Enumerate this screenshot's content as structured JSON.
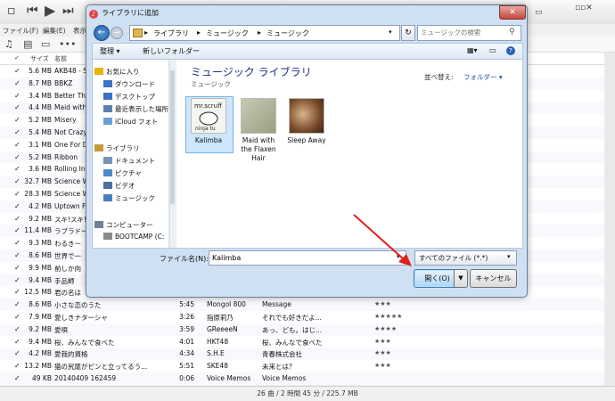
{
  "itunes": {
    "menus": [
      "ファイル(F)",
      "編集(E)",
      "表示"
    ],
    "colhead": {
      "size": "サイズ",
      "name": "名前"
    },
    "rows": [
      {
        "check": "✓",
        "size": "5.6 MB",
        "name": "AKB48 - S",
        "time": "",
        "artist": "",
        "album": "",
        "rating": ""
      },
      {
        "check": "✓",
        "size": "8.7 MB",
        "name": "BBKZ",
        "time": "",
        "artist": "",
        "album": "",
        "rating": ""
      },
      {
        "check": "✓",
        "size": "3.4 MB",
        "name": "Better Tha",
        "time": "",
        "artist": "",
        "album": "",
        "rating": ""
      },
      {
        "check": "✓",
        "size": "4.4 MB",
        "name": "Maid with",
        "time": "",
        "artist": "",
        "album": "",
        "rating": ""
      },
      {
        "check": "✓",
        "size": "5.2 MB",
        "name": "Misery",
        "time": "",
        "artist": "",
        "album": "",
        "rating": ""
      },
      {
        "check": "✓",
        "size": "5.4 MB",
        "name": "Not Crazy",
        "time": "",
        "artist": "",
        "album": "",
        "rating": ""
      },
      {
        "check": "✓",
        "size": "3.1 MB",
        "name": "One For D",
        "time": "",
        "artist": "",
        "album": "",
        "rating": ""
      },
      {
        "check": "✓",
        "size": "5.2 MB",
        "name": "Ribbon",
        "time": "",
        "artist": "",
        "album": "",
        "rating": ""
      },
      {
        "check": "✓",
        "size": "3.6 MB",
        "name": "Rolling In",
        "time": "",
        "artist": "",
        "album": "",
        "rating": ""
      },
      {
        "check": "✓",
        "size": "32.7 MB",
        "name": "Science W",
        "time": "",
        "artist": "",
        "album": "",
        "rating": ""
      },
      {
        "check": "✓",
        "size": "28.3 MB",
        "name": "Science W",
        "time": "",
        "artist": "",
        "album": "",
        "rating": ""
      },
      {
        "check": "✓",
        "size": "4.2 MB",
        "name": "Uptown Fu",
        "time": "",
        "artist": "",
        "album": "",
        "rating": ""
      },
      {
        "check": "✓",
        "size": "9.2 MB",
        "name": "スキ!スキ!",
        "time": "",
        "artist": "",
        "album": "",
        "rating": ""
      },
      {
        "check": "✓",
        "size": "11.4 MB",
        "name": "ラブラドー",
        "time": "",
        "artist": "",
        "album": "",
        "rating": ""
      },
      {
        "check": "✓",
        "size": "9.3 MB",
        "name": "わるきー",
        "time": "",
        "artist": "",
        "album": "",
        "rating": ""
      },
      {
        "check": "✓",
        "size": "8.6 MB",
        "name": "世界で一",
        "time": "",
        "artist": "",
        "album": "",
        "rating": ""
      },
      {
        "check": "✓",
        "size": "9.9 MB",
        "name": "前しか向",
        "time": "",
        "artist": "",
        "album": "",
        "rating": ""
      },
      {
        "check": "✓",
        "size": "9.4 MB",
        "name": "手品師",
        "time": "",
        "artist": "",
        "album": "",
        "rating": ""
      },
      {
        "check": "✓",
        "size": "12.5 MB",
        "name": "君の名は",
        "time": "",
        "artist": "",
        "album": "",
        "rating": ""
      },
      {
        "check": "✓",
        "size": "8.6 MB",
        "name": "小さな恋のうた",
        "time": "5:45",
        "artist": "Mongol 800",
        "album": "Message",
        "rating": "★★★"
      },
      {
        "check": "✓",
        "size": "7.9 MB",
        "name": "愛しきナターシャ",
        "time": "3:26",
        "artist": "指原莉乃",
        "album": "それでも好きだよ...",
        "rating": "★★★★★"
      },
      {
        "check": "✓",
        "size": "9.2 MB",
        "name": "愛唄",
        "time": "3:59",
        "artist": "GReeeeN",
        "album": "あっ、ども。はじ...",
        "rating": "★★★★"
      },
      {
        "check": "✓",
        "size": "9.4 MB",
        "name": "桜、みんなで食べた",
        "time": "4:01",
        "artist": "HKT48",
        "album": "桜、みんなで食べた",
        "rating": "★★★"
      },
      {
        "check": "✓",
        "size": "4.2 MB",
        "name": "愛我的資格",
        "time": "4:34",
        "artist": "S.H.E",
        "album": "青春株式会社",
        "rating": "★★★"
      },
      {
        "check": "✓",
        "size": "13.2 MB",
        "name": "猫の尻尾がピンと立ってるう...",
        "time": "5:51",
        "artist": "SKE48",
        "album": "未来とは？",
        "rating": "★★★"
      },
      {
        "check": "✓",
        "size": "49 KB",
        "name": "20140409 162459",
        "time": "0:06",
        "artist": "Voice Memos",
        "album": "Voice Memos",
        "rating": ""
      }
    ],
    "status": "26 曲 / 2 時間 45 分 / 225.7 MB"
  },
  "dialog": {
    "title": "ライブラリに追加",
    "close": "✕",
    "breadcrumbs": [
      "ライブラリ",
      "ミュージック",
      "ミュージック"
    ],
    "search_placeholder": "ミュージックの検索",
    "commands": {
      "organize": "整理 ▾",
      "new_folder": "新しいフォルダー"
    },
    "nav": [
      {
        "label": "お気に入り",
        "icon": "star-icon",
        "color": "#e8b400"
      },
      {
        "label": "ダウンロード",
        "icon": "download-icon",
        "color": "#3b73c7"
      },
      {
        "label": "デスクトップ",
        "icon": "desktop-icon",
        "color": "#3b73c7"
      },
      {
        "label": "最近表示した場所",
        "icon": "recent-icon",
        "color": "#5b7fb0"
      },
      {
        "label": "iCloud フォト",
        "icon": "icloud-icon",
        "color": "#6aa0d8"
      },
      {
        "label": "ライブラリ",
        "icon": "library-icon",
        "color": "#c49a3a"
      },
      {
        "label": "ドキュメント",
        "icon": "documents-icon",
        "color": "#7a93b5"
      },
      {
        "label": "ピクチャ",
        "icon": "pictures-icon",
        "color": "#4d8ac5"
      },
      {
        "label": "ビデオ",
        "icon": "videos-icon",
        "color": "#4d6fa5"
      },
      {
        "label": "ミュージック",
        "icon": "music-icon",
        "color": "#4a7fc0"
      },
      {
        "label": "コンピューター",
        "icon": "computer-icon",
        "color": "#6d8199"
      },
      {
        "label": "BOOTCAMP (C:",
        "icon": "drive-icon",
        "color": "#8a8a8a"
      }
    ],
    "library_title": "ミュージック ライブラリ",
    "library_sub": "ミュージック",
    "sort_label": "並べ替え:",
    "sort_value": "フォルダー ▾",
    "albums": [
      {
        "label": "Kalimba"
      },
      {
        "label": "Maid with the Flaxen Hair"
      },
      {
        "label": "Sleep Away"
      }
    ],
    "filename_label": "ファイル名(N):",
    "filename_value": "Kalimba",
    "filetype": "すべてのファイル (*.*)",
    "open_label": "開く(O)",
    "cancel_label": "キャンセル"
  }
}
